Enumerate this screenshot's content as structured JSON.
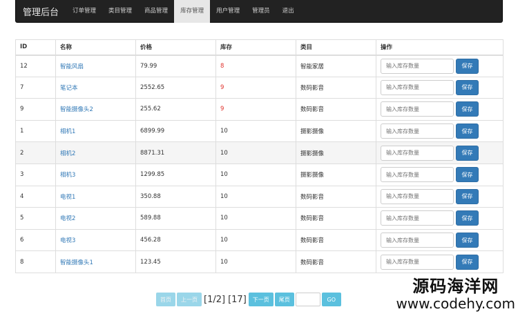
{
  "navbar": {
    "brand": "管理后台",
    "items": [
      "订单管理",
      "类目管理",
      "商品管理",
      "库存管理",
      "用户管理",
      "管理员",
      "退出"
    ],
    "active_index": 3
  },
  "table": {
    "headers": [
      "ID",
      "名称",
      "价格",
      "库存",
      "类目",
      "操作"
    ],
    "placeholder": "输入库存数量",
    "save_label": "保存",
    "rows": [
      {
        "id": "12",
        "name": "智能风扇",
        "price": "79.99",
        "stock": "8",
        "category": "智能家居",
        "low": true
      },
      {
        "id": "7",
        "name": "笔记本",
        "price": "2552.65",
        "stock": "9",
        "category": "数码影音",
        "low": true
      },
      {
        "id": "9",
        "name": "智能摄像头2",
        "price": "255.62",
        "stock": "9",
        "category": "数码影音",
        "low": true
      },
      {
        "id": "1",
        "name": "相机1",
        "price": "6899.99",
        "stock": "10",
        "category": "摄影摄像",
        "low": false
      },
      {
        "id": "2",
        "name": "相机2",
        "price": "8871.31",
        "stock": "10",
        "category": "摄影摄像",
        "low": false
      },
      {
        "id": "3",
        "name": "相机3",
        "price": "1299.85",
        "stock": "10",
        "category": "摄影摄像",
        "low": false
      },
      {
        "id": "4",
        "name": "电视1",
        "price": "350.88",
        "stock": "10",
        "category": "数码影音",
        "low": false
      },
      {
        "id": "5",
        "name": "电视2",
        "price": "589.88",
        "stock": "10",
        "category": "数码影音",
        "low": false
      },
      {
        "id": "6",
        "name": "电视3",
        "price": "456.28",
        "stock": "10",
        "category": "数码影音",
        "low": false
      },
      {
        "id": "8",
        "name": "智能摄像头1",
        "price": "123.45",
        "stock": "10",
        "category": "数码影音",
        "low": false
      }
    ]
  },
  "pagination": {
    "first": "首页",
    "prev": "上一页",
    "page_info": "[1/2]",
    "total": "[17]",
    "next": "下一页",
    "last": "尾页",
    "go": "GO"
  },
  "watermark": {
    "line1": "源码海洋网",
    "line2": "www.codehy.com"
  },
  "colors": {
    "navbar_bg": "#222222",
    "primary": "#337ab7",
    "info": "#5bc0de",
    "low_stock": "#e0312b"
  }
}
